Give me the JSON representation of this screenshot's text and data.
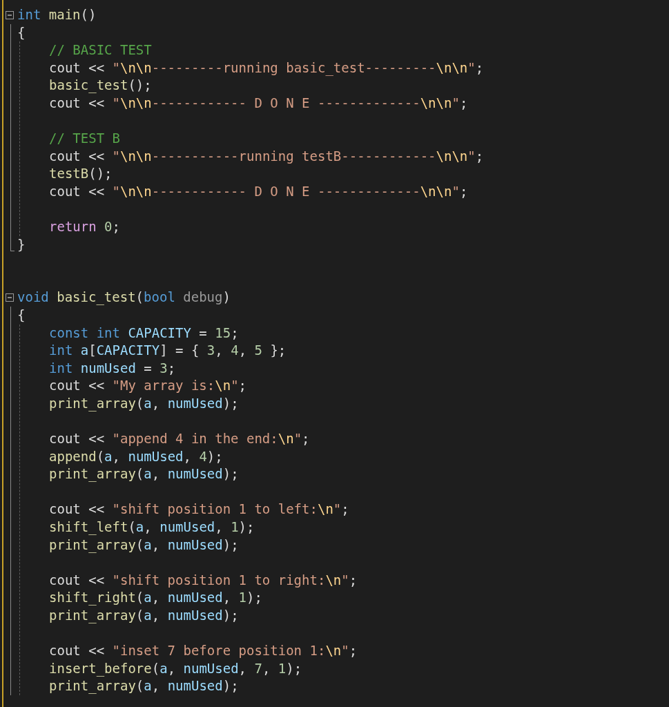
{
  "functions": [
    {
      "expanded": true,
      "signature": [
        {
          "kind": "kw",
          "text": "int"
        },
        {
          "kind": "fn",
          "text": " main"
        },
        {
          "kind": "p",
          "text": "()"
        }
      ],
      "open": "{",
      "groups": [
        [
          [
            {
              "kind": "cm",
              "text": "// BASIC TEST"
            }
          ],
          [
            {
              "kind": "p",
              "text": "cout << "
            },
            {
              "kind": "str",
              "text": "\""
            },
            {
              "kind": "esc",
              "text": "\\n\\n"
            },
            {
              "kind": "str",
              "text": "---------running basic_test---------"
            },
            {
              "kind": "esc",
              "text": "\\n\\n"
            },
            {
              "kind": "str",
              "text": "\""
            },
            {
              "kind": "p",
              "text": ";"
            }
          ],
          [
            {
              "kind": "fn",
              "text": "basic_test"
            },
            {
              "kind": "p",
              "text": "();"
            }
          ],
          [
            {
              "kind": "p",
              "text": "cout << "
            },
            {
              "kind": "str",
              "text": "\""
            },
            {
              "kind": "esc",
              "text": "\\n\\n"
            },
            {
              "kind": "str",
              "text": "------------ D O N E -------------"
            },
            {
              "kind": "esc",
              "text": "\\n\\n"
            },
            {
              "kind": "str",
              "text": "\""
            },
            {
              "kind": "p",
              "text": ";"
            }
          ]
        ],
        [
          [
            {
              "kind": "cm",
              "text": "// TEST B"
            }
          ],
          [
            {
              "kind": "p",
              "text": "cout << "
            },
            {
              "kind": "str",
              "text": "\""
            },
            {
              "kind": "esc",
              "text": "\\n\\n"
            },
            {
              "kind": "str",
              "text": "-----------running testB------------"
            },
            {
              "kind": "esc",
              "text": "\\n\\n"
            },
            {
              "kind": "str",
              "text": "\""
            },
            {
              "kind": "p",
              "text": ";"
            }
          ],
          [
            {
              "kind": "fn",
              "text": "testB"
            },
            {
              "kind": "p",
              "text": "();"
            }
          ],
          [
            {
              "kind": "p",
              "text": "cout << "
            },
            {
              "kind": "str",
              "text": "\""
            },
            {
              "kind": "esc",
              "text": "\\n\\n"
            },
            {
              "kind": "str",
              "text": "------------ D O N E -------------"
            },
            {
              "kind": "esc",
              "text": "\\n\\n"
            },
            {
              "kind": "str",
              "text": "\""
            },
            {
              "kind": "p",
              "text": ";"
            }
          ]
        ],
        [
          [
            {
              "kind": "ctl",
              "text": "return"
            },
            {
              "kind": "num",
              "text": " 0"
            },
            {
              "kind": "p",
              "text": ";"
            }
          ]
        ]
      ],
      "close": "}"
    },
    {
      "expanded": true,
      "signature": [
        {
          "kind": "kw",
          "text": "void"
        },
        {
          "kind": "fn",
          "text": " basic_test"
        },
        {
          "kind": "p",
          "text": "("
        },
        {
          "kind": "kw",
          "text": "bool"
        },
        {
          "kind": "param",
          "text": " debug"
        },
        {
          "kind": "p",
          "text": ")"
        }
      ],
      "open": "{",
      "groups": [
        [
          [
            {
              "kind": "kw",
              "text": "const"
            },
            {
              "kind": "kw",
              "text": " int"
            },
            {
              "kind": "var",
              "text": " CAPACITY"
            },
            {
              "kind": "p",
              "text": " = "
            },
            {
              "kind": "num",
              "text": "15"
            },
            {
              "kind": "p",
              "text": ";"
            }
          ],
          [
            {
              "kind": "kw",
              "text": "int"
            },
            {
              "kind": "var",
              "text": " a"
            },
            {
              "kind": "p",
              "text": "["
            },
            {
              "kind": "var",
              "text": "CAPACITY"
            },
            {
              "kind": "p",
              "text": "] = { "
            },
            {
              "kind": "num",
              "text": "3"
            },
            {
              "kind": "p",
              "text": ", "
            },
            {
              "kind": "num",
              "text": "4"
            },
            {
              "kind": "p",
              "text": ", "
            },
            {
              "kind": "num",
              "text": "5"
            },
            {
              "kind": "p",
              "text": " };"
            }
          ],
          [
            {
              "kind": "kw",
              "text": "int"
            },
            {
              "kind": "var",
              "text": " numUsed"
            },
            {
              "kind": "p",
              "text": " = "
            },
            {
              "kind": "num",
              "text": "3"
            },
            {
              "kind": "p",
              "text": ";"
            }
          ],
          [
            {
              "kind": "p",
              "text": "cout << "
            },
            {
              "kind": "str",
              "text": "\"My array is:"
            },
            {
              "kind": "esc",
              "text": "\\n"
            },
            {
              "kind": "str",
              "text": "\""
            },
            {
              "kind": "p",
              "text": ";"
            }
          ],
          [
            {
              "kind": "fn",
              "text": "print_array"
            },
            {
              "kind": "p",
              "text": "("
            },
            {
              "kind": "var",
              "text": "a"
            },
            {
              "kind": "p",
              "text": ", "
            },
            {
              "kind": "var",
              "text": "numUsed"
            },
            {
              "kind": "p",
              "text": ");"
            }
          ]
        ],
        [
          [
            {
              "kind": "p",
              "text": "cout << "
            },
            {
              "kind": "str",
              "text": "\"append 4 in the end:"
            },
            {
              "kind": "esc",
              "text": "\\n"
            },
            {
              "kind": "str",
              "text": "\""
            },
            {
              "kind": "p",
              "text": ";"
            }
          ],
          [
            {
              "kind": "fn",
              "text": "append"
            },
            {
              "kind": "p",
              "text": "("
            },
            {
              "kind": "var",
              "text": "a"
            },
            {
              "kind": "p",
              "text": ", "
            },
            {
              "kind": "var",
              "text": "numUsed"
            },
            {
              "kind": "p",
              "text": ", "
            },
            {
              "kind": "num",
              "text": "4"
            },
            {
              "kind": "p",
              "text": ");"
            }
          ],
          [
            {
              "kind": "fn",
              "text": "print_array"
            },
            {
              "kind": "p",
              "text": "("
            },
            {
              "kind": "var",
              "text": "a"
            },
            {
              "kind": "p",
              "text": ", "
            },
            {
              "kind": "var",
              "text": "numUsed"
            },
            {
              "kind": "p",
              "text": ");"
            }
          ]
        ],
        [
          [
            {
              "kind": "p",
              "text": "cout << "
            },
            {
              "kind": "str",
              "text": "\"shift position 1 to left:"
            },
            {
              "kind": "esc",
              "text": "\\n"
            },
            {
              "kind": "str",
              "text": "\""
            },
            {
              "kind": "p",
              "text": ";"
            }
          ],
          [
            {
              "kind": "fn",
              "text": "shift_left"
            },
            {
              "kind": "p",
              "text": "("
            },
            {
              "kind": "var",
              "text": "a"
            },
            {
              "kind": "p",
              "text": ", "
            },
            {
              "kind": "var",
              "text": "numUsed"
            },
            {
              "kind": "p",
              "text": ", "
            },
            {
              "kind": "num",
              "text": "1"
            },
            {
              "kind": "p",
              "text": ");"
            }
          ],
          [
            {
              "kind": "fn",
              "text": "print_array"
            },
            {
              "kind": "p",
              "text": "("
            },
            {
              "kind": "var",
              "text": "a"
            },
            {
              "kind": "p",
              "text": ", "
            },
            {
              "kind": "var",
              "text": "numUsed"
            },
            {
              "kind": "p",
              "text": ");"
            }
          ]
        ],
        [
          [
            {
              "kind": "p",
              "text": "cout << "
            },
            {
              "kind": "str",
              "text": "\"shift position 1 to right:"
            },
            {
              "kind": "esc",
              "text": "\\n"
            },
            {
              "kind": "str",
              "text": "\""
            },
            {
              "kind": "p",
              "text": ";"
            }
          ],
          [
            {
              "kind": "fn",
              "text": "shift_right"
            },
            {
              "kind": "p",
              "text": "("
            },
            {
              "kind": "var",
              "text": "a"
            },
            {
              "kind": "p",
              "text": ", "
            },
            {
              "kind": "var",
              "text": "numUsed"
            },
            {
              "kind": "p",
              "text": ", "
            },
            {
              "kind": "num",
              "text": "1"
            },
            {
              "kind": "p",
              "text": ");"
            }
          ],
          [
            {
              "kind": "fn",
              "text": "print_array"
            },
            {
              "kind": "p",
              "text": "("
            },
            {
              "kind": "var",
              "text": "a"
            },
            {
              "kind": "p",
              "text": ", "
            },
            {
              "kind": "var",
              "text": "numUsed"
            },
            {
              "kind": "p",
              "text": ");"
            }
          ]
        ],
        [
          [
            {
              "kind": "p",
              "text": "cout << "
            },
            {
              "kind": "str",
              "text": "\"inset 7 before position 1:"
            },
            {
              "kind": "esc",
              "text": "\\n"
            },
            {
              "kind": "str",
              "text": "\""
            },
            {
              "kind": "p",
              "text": ";"
            }
          ],
          [
            {
              "kind": "fn",
              "text": "insert_before"
            },
            {
              "kind": "p",
              "text": "("
            },
            {
              "kind": "var",
              "text": "a"
            },
            {
              "kind": "p",
              "text": ", "
            },
            {
              "kind": "var",
              "text": "numUsed"
            },
            {
              "kind": "p",
              "text": ", "
            },
            {
              "kind": "num",
              "text": "7"
            },
            {
              "kind": "p",
              "text": ", "
            },
            {
              "kind": "num",
              "text": "1"
            },
            {
              "kind": "p",
              "text": ");"
            }
          ],
          [
            {
              "kind": "fn",
              "text": "print_array"
            },
            {
              "kind": "p",
              "text": "("
            },
            {
              "kind": "var",
              "text": "a"
            },
            {
              "kind": "p",
              "text": ", "
            },
            {
              "kind": "var",
              "text": "numUsed"
            },
            {
              "kind": "p",
              "text": ");"
            }
          ]
        ]
      ]
    }
  ]
}
